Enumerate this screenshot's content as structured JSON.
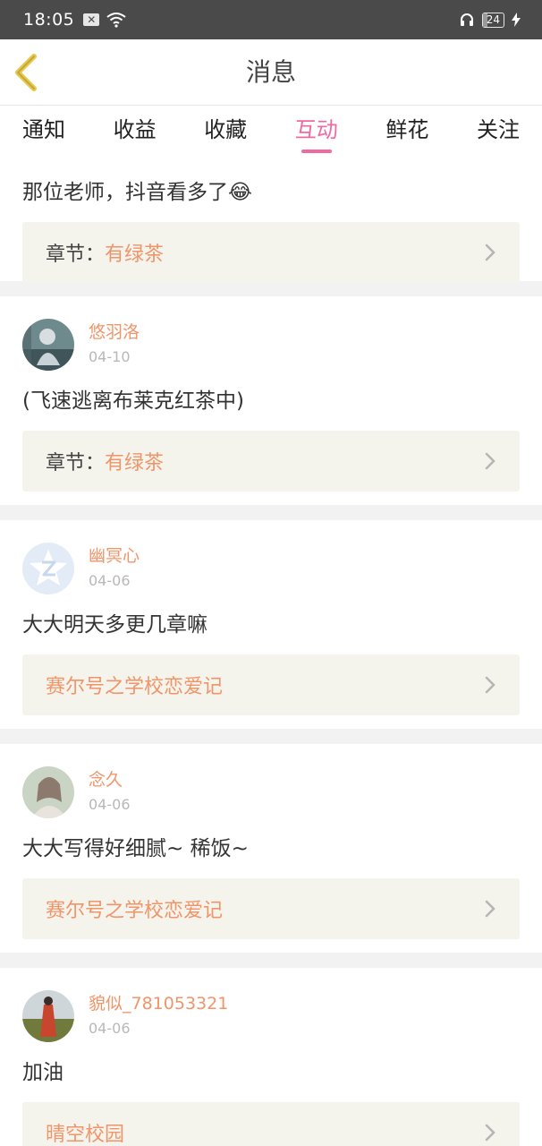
{
  "status_bar": {
    "time": "18:05",
    "battery": "24"
  },
  "header": {
    "title": "消息"
  },
  "tabs": [
    {
      "label": "通知"
    },
    {
      "label": "收益"
    },
    {
      "label": "收藏"
    },
    {
      "label": "互动",
      "active": true
    },
    {
      "label": "鲜花"
    },
    {
      "label": "关注"
    }
  ],
  "feed": {
    "partial_top": {
      "text": "那位老师，抖音看多了😂",
      "chapter_label": "章节：",
      "chapter_name": "有绿茶"
    },
    "items": [
      {
        "user": "悠羽洛",
        "date": "04-10",
        "text": "(飞速逃离布莱克红茶中)",
        "chapter_label": "章节：",
        "chapter_name": "有绿茶"
      },
      {
        "user": "幽冥心",
        "date": "04-06",
        "text": "大大明天多更几章嘛",
        "chapter_label": "",
        "chapter_name": "赛尔号之学校恋爱记"
      },
      {
        "user": "念久",
        "date": "04-06",
        "text": "大大写得好细腻~ 稀饭~",
        "chapter_label": "",
        "chapter_name": "赛尔号之学校恋爱记"
      },
      {
        "user": "貌似_781053321",
        "date": "04-06",
        "text": "加油",
        "chapter_label": "",
        "chapter_name": "晴空校园"
      }
    ]
  },
  "colors": {
    "accent_pink": "#ef6aa3",
    "accent_orange": "#f0956a",
    "back_arrow": "#e8c94a"
  }
}
